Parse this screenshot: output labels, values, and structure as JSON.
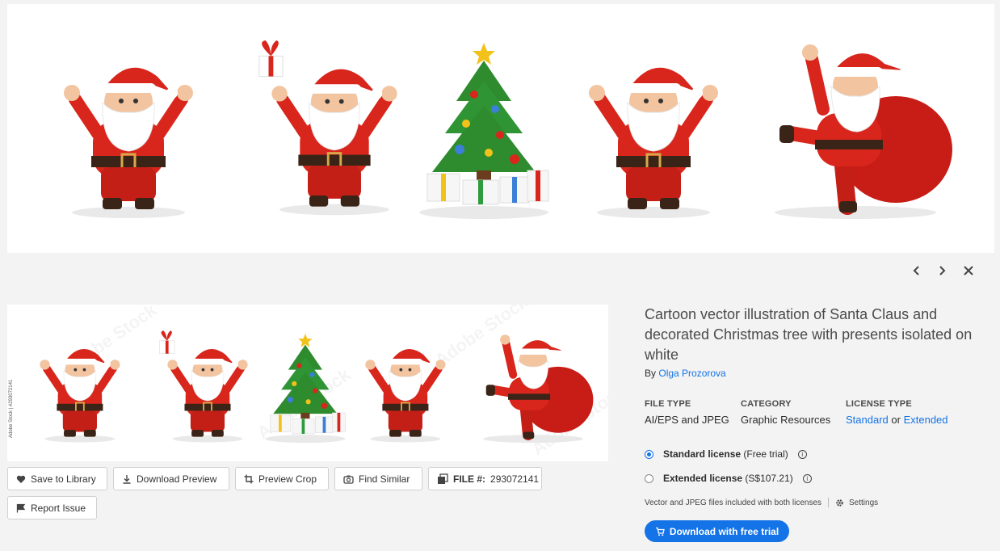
{
  "nav": {
    "prev_icon": "chevron-left-icon",
    "next_icon": "chevron-right-icon",
    "close_icon": "close-icon"
  },
  "asset": {
    "title": "Cartoon vector illustration of Santa Claus and decorated Christmas tree with presents isolated on white",
    "by_prefix": "By",
    "author": "Olga Prozorova",
    "thumb_side_id": "Adobe Stock | #293072141",
    "watermark": "Adobe Stock"
  },
  "actions": {
    "save_to_library": "Save to Library",
    "download_preview": "Download Preview",
    "preview_crop": "Preview Crop",
    "find_similar": "Find Similar",
    "file_label": "FILE #:",
    "file_number": "293072141",
    "report_issue": "Report Issue"
  },
  "meta": {
    "file_type_label": "FILE TYPE",
    "file_type_value": "AI/EPS and JPEG",
    "category_label": "CATEGORY",
    "category_value": "Graphic Resources",
    "license_type_label": "LICENSE TYPE",
    "license_standard": "Standard",
    "license_or": "or",
    "license_extended": "Extended"
  },
  "licenses": {
    "standard_label": "Standard license",
    "standard_note": "(Free trial)",
    "extended_label": "Extended license",
    "extended_note": "(S$107.21)",
    "included_note": "Vector and JPEG files included with both licenses",
    "settings": "Settings"
  },
  "cta": {
    "label": "Download with free trial"
  },
  "colors": {
    "accent": "#1473e6",
    "santa_red": "#d9261c",
    "tree_green": "#2e8b2e"
  }
}
